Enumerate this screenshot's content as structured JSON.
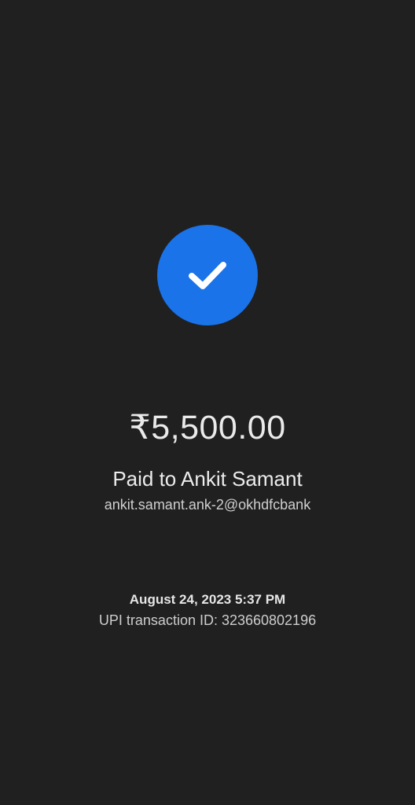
{
  "status": {
    "icon": "check-icon",
    "accent_color": "#1a73e8",
    "background_color": "#202020"
  },
  "payment": {
    "amount": "₹5,500.00",
    "paid_to": "Paid to Ankit Samant",
    "upi_id": "ankit.samant.ank-2@okhdfcbank"
  },
  "transaction": {
    "datetime": "August 24, 2023 5:37 PM",
    "upi_transaction_id": "UPI transaction ID: 323660802196"
  }
}
